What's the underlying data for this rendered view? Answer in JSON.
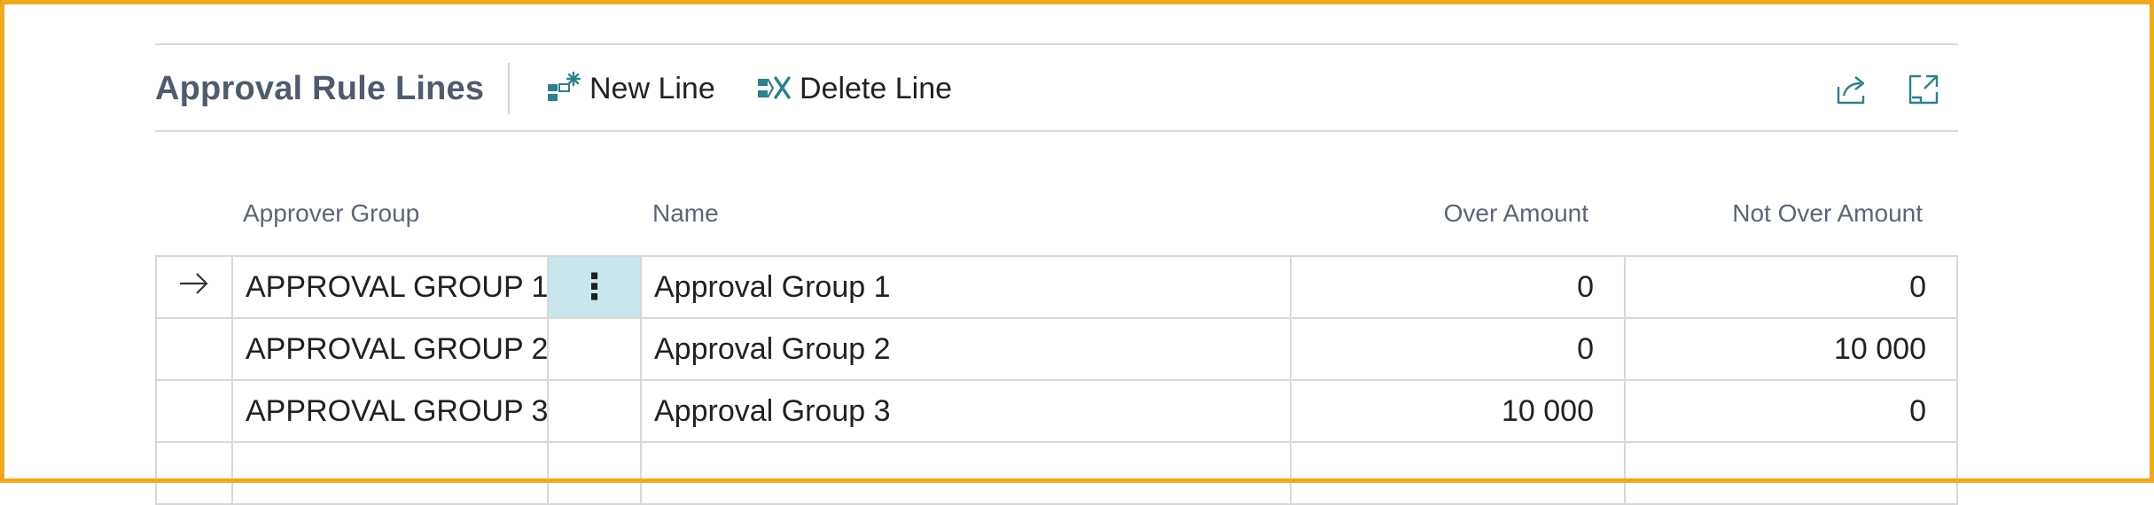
{
  "header": {
    "title": "Approval Rule Lines",
    "actions": [
      {
        "label": "New Line",
        "icon": "new-line-icon"
      },
      {
        "label": "Delete Line",
        "icon": "delete-line-icon"
      }
    ],
    "tools": [
      {
        "icon": "share-icon"
      },
      {
        "icon": "expand-icon"
      }
    ]
  },
  "table": {
    "columns": {
      "approver_group": "Approver Group",
      "name": "Name",
      "over_amount": "Over Amount",
      "not_over_amount": "Not Over Amount"
    },
    "rows": [
      {
        "selected": true,
        "approver_group": "APPROVAL GROUP 1",
        "name": "Approval Group 1",
        "over_amount": "0",
        "not_over_amount": "0"
      },
      {
        "selected": false,
        "approver_group": "APPROVAL GROUP 2",
        "name": "Approval Group 2",
        "over_amount": "0",
        "not_over_amount": "10 000"
      },
      {
        "selected": false,
        "approver_group": "APPROVAL GROUP 3",
        "name": "Approval Group 3",
        "over_amount": "10 000",
        "not_over_amount": "0"
      },
      {
        "selected": false,
        "approver_group": "",
        "name": "",
        "over_amount": "",
        "not_over_amount": ""
      }
    ],
    "row_indicator_icon": "arrow-right-icon",
    "row_menu_icon": "vertical-dots-icon"
  },
  "colors": {
    "frame": "#f0a91e",
    "accent": "#2f7f8c",
    "active_cell": "#c9e6ec",
    "title_text": "#505b6b",
    "header_text": "#5b6577"
  }
}
